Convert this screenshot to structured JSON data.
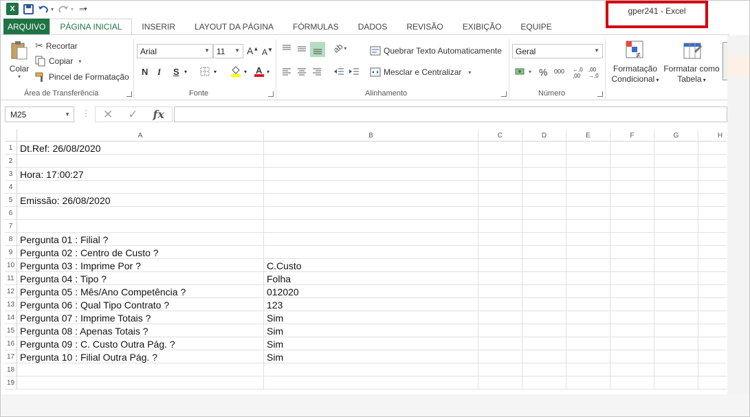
{
  "window": {
    "title": "gper241 - Excel"
  },
  "qat": {
    "logo": "X",
    "logo_icon": "excel-logo-icon",
    "save_icon": "save-icon",
    "undo_icon": "undo-icon",
    "redo_icon": "redo-icon",
    "customize_icon": "customize-qat-icon"
  },
  "tabs": [
    {
      "label": "ARQUIVO"
    },
    {
      "label": "PÁGINA INICIAL"
    },
    {
      "label": "INSERIR"
    },
    {
      "label": "LAYOUT DA PÁGINA"
    },
    {
      "label": "FÓRMULAS"
    },
    {
      "label": "DADOS"
    },
    {
      "label": "REVISÃO"
    },
    {
      "label": "EXIBIÇÃO"
    },
    {
      "label": "EQUIPE"
    }
  ],
  "ribbon": {
    "clipboard": {
      "label": "Área de Transferência",
      "paste": "Colar",
      "cut": "Recortar",
      "copy": "Copiar",
      "format_painter": "Pincel de Formatação"
    },
    "font": {
      "label": "Fonte",
      "font_name": "Arial",
      "font_size": "11",
      "bold": "N",
      "italic": "I",
      "underline": "S",
      "grow": "A",
      "shrink": "A"
    },
    "alignment": {
      "label": "Alinhamento",
      "wrap_text": "Quebrar Texto Automaticamente",
      "merge_center": "Mesclar e Centralizar"
    },
    "number": {
      "label": "Número",
      "format": "Geral",
      "percent": "%",
      "thousands": "000",
      "inc_decimal": "←,0 ,00",
      "dec_decimal": ",00 →,0"
    },
    "styles": {
      "conditional_line1": "Formatação",
      "conditional_line2": "Condicional",
      "table_line1": "Formatar como",
      "table_line2": "Tabela"
    }
  },
  "formula_bar": {
    "name_box": "M25",
    "fx": "fx",
    "value": ""
  },
  "columns": [
    "A",
    "B",
    "C",
    "D",
    "E",
    "F",
    "G",
    "H"
  ],
  "rows": [
    {
      "n": "1",
      "a": "Dt.Ref: 26/08/2020",
      "b": ""
    },
    {
      "n": "2",
      "a": "",
      "b": ""
    },
    {
      "n": "3",
      "a": "Hora: 17:00:27",
      "b": ""
    },
    {
      "n": "4",
      "a": "",
      "b": ""
    },
    {
      "n": "5",
      "a": "Emissão: 26/08/2020",
      "b": ""
    },
    {
      "n": "6",
      "a": "",
      "b": ""
    },
    {
      "n": "7",
      "a": "",
      "b": ""
    },
    {
      "n": "8",
      "a": "Pergunta 01 : Filial ?",
      "b": ""
    },
    {
      "n": "9",
      "a": "Pergunta 02 : Centro de Custo ?",
      "b": ""
    },
    {
      "n": "10",
      "a": "Pergunta 03 : Imprime Por ?",
      "b": "C.Custo"
    },
    {
      "n": "11",
      "a": "Pergunta 04 : Tipo ?",
      "b": "Folha"
    },
    {
      "n": "12",
      "a": "Pergunta 05 : Mês/Ano Competência ?",
      "b": "012020"
    },
    {
      "n": "13",
      "a": "Pergunta 06 : Qual Tipo Contrato ?",
      "b": "123"
    },
    {
      "n": "14",
      "a": "Pergunta 07 : Imprime Totais ?",
      "b": "Sim"
    },
    {
      "n": "15",
      "a": "Pergunta 08 : Apenas Totais ?",
      "b": "Sim"
    },
    {
      "n": "16",
      "a": "Pergunta 09 : C. Custo Outra Pág. ?",
      "b": "Sim"
    },
    {
      "n": "17",
      "a": "Pergunta 10 : Filial Outra Pág. ?",
      "b": "Sim"
    },
    {
      "n": "18",
      "a": "",
      "b": ""
    },
    {
      "n": "19",
      "a": "",
      "b": ""
    }
  ],
  "colors": {
    "accent": "#217346",
    "highlight_border": "#d3000e"
  }
}
